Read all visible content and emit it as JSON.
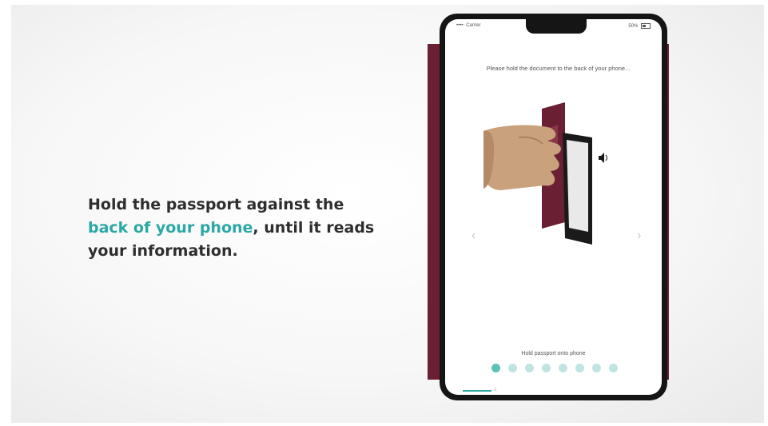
{
  "caption": {
    "line1": "Hold the passport against the",
    "highlight": "back of your phone",
    "rest": ", until it reads",
    "line3": "your information."
  },
  "phone": {
    "status": {
      "carrier": "••••◦ Carrier",
      "battery": "50%"
    },
    "instruction": "Please hold the document to the back of your phone...",
    "nav": {
      "prev": "‹",
      "next": "›"
    },
    "slide_label": "Hold passport onto phone",
    "pagination": {
      "total": 8,
      "active": 1
    },
    "home_text": "1:"
  },
  "colors": {
    "accent": "#2aa8a4",
    "passport": "#6b1f33",
    "dot": "#bfe5e1",
    "dot_active": "#5cc3b9"
  }
}
